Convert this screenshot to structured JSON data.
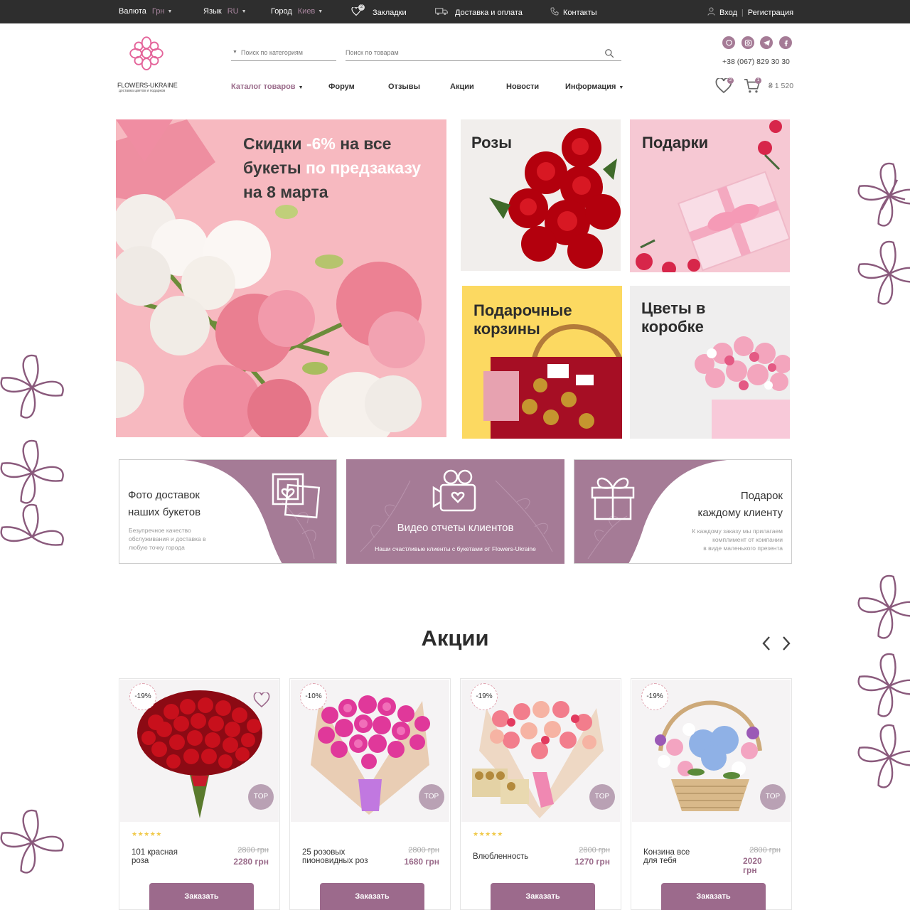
{
  "topbar": {
    "currency_label": "Валюта",
    "currency_value": "Грн",
    "language_label": "Язык",
    "language_value": "RU",
    "city_label": "Город",
    "city_value": "Киев",
    "bookmarks_label": "Закладки",
    "bookmarks_count": "2",
    "delivery_label": "Доставка и оплата",
    "contacts_label": "Контакты",
    "login_label": "Вход",
    "register_label": "Регистрация"
  },
  "header": {
    "logo_name": "FLOWERS-UKRAINE",
    "logo_tagline": "доставка цветов и подарков",
    "category_search_placeholder": "Поиск по категориям",
    "product_search_placeholder": "Поиск по товарам",
    "phone": "+38 (067) 829 30 30",
    "wishlist_count": "2",
    "cart_count": "1",
    "cart_total": "₴ 1 520",
    "social": [
      "viber-icon",
      "instagram-icon",
      "telegram-icon",
      "facebook-icon"
    ]
  },
  "nav": {
    "catalog": "Каталог товаров",
    "forum": "Форум",
    "reviews": "Отзывы",
    "promos": "Акции",
    "news": "Новости",
    "info": "Информация"
  },
  "hero": {
    "line1_a": "Скидки ",
    "line1_b": "-6%",
    "line1_c": " на все",
    "line2_a": "букеты ",
    "line2_b": "по предзаказу",
    "line3": "на 8 марта"
  },
  "tiles": {
    "roses": "Розы",
    "gifts": "Подарки",
    "baskets_1": "Подарочные",
    "baskets_2": "корзины",
    "box_1": "Цветы в",
    "box_2": "коробке"
  },
  "features": [
    {
      "title_1": "Фото доставок",
      "title_2": "наших букетов",
      "sub_1": "Безупречное качество",
      "sub_2": "обслуживания и доставка в",
      "sub_3": "любую точку города"
    },
    {
      "title_1": "Видео отчеты клиентов",
      "sub_1": "Наши счастливые клиенты с букетами от Flowers-Ukraine"
    },
    {
      "title_1": "Подарок",
      "title_2": "каждому клиенту",
      "sub_1": "К каждому заказу мы прилагаем",
      "sub_2": "комплимент от компании",
      "sub_3": "в виде маленького презента"
    }
  ],
  "promos": {
    "title": "Акции",
    "products": [
      {
        "discount": "-19%",
        "name_1": "101 красная",
        "name_2": "роза",
        "old_price": "2800 грн",
        "new_price": "2280 грн",
        "badge": "TOP",
        "rating_stars": 5,
        "stars": "★★★★★",
        "order_label": "Заказать"
      },
      {
        "discount": "-10%",
        "name_1": "25 розовых",
        "name_2": "пионовидных роз",
        "old_price": "2800 грн",
        "new_price": "1680 грн",
        "badge": "TOP",
        "order_label": "Заказать"
      },
      {
        "discount": "-19%",
        "name_1": "Влюбленность",
        "name_2": "",
        "old_price": "2800 грн",
        "new_price": "1270 грн",
        "badge": "TOP",
        "rating_stars": 5,
        "stars": "★★★★★",
        "order_label": "Заказать"
      },
      {
        "discount": "-19%",
        "name_1": "Конзина все",
        "name_2": "для тебя",
        "old_price": "2800 грн",
        "new_price_1": "2020",
        "new_price_2": "грн",
        "badge": "TOP",
        "order_label": "Заказать"
      }
    ]
  },
  "colors": {
    "accent": "#9c6a8c",
    "topbar": "#2e2e2e",
    "feature_bg": "#a57b96",
    "hero_bg": "#f6b8bf",
    "yellow_tile": "#fcd961"
  }
}
